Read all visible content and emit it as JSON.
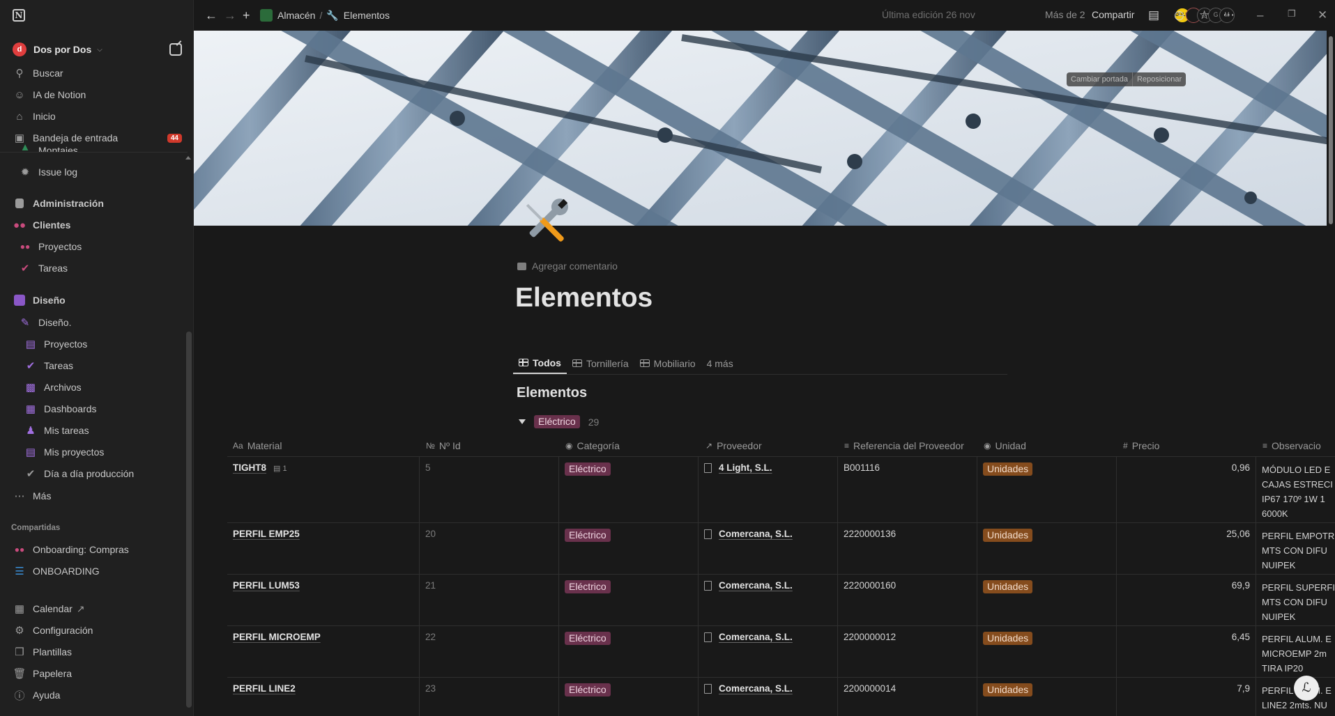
{
  "sidebar": {
    "workspace": "Dos por Dos",
    "workspace_initial": "d",
    "top": [
      {
        "label": "Buscar",
        "icon": "search-icon"
      },
      {
        "label": "IA de Notion",
        "icon": "ai-face-icon"
      },
      {
        "label": "Inicio",
        "icon": "home-icon"
      },
      {
        "label": "Bandeja de entrada",
        "icon": "inbox-icon",
        "badge": "44"
      }
    ],
    "cut_item": "Montajes",
    "pages": [
      {
        "label": "Issue log",
        "icon": "bug-icon"
      },
      {
        "label": "Administración",
        "icon": "document-icon"
      },
      {
        "label": "Clientes",
        "icon": "people-icon"
      },
      {
        "label": "Proyectos",
        "icon": "people-icon"
      },
      {
        "label": "Tareas",
        "icon": "check-circle-icon"
      },
      {
        "label": "Diseño",
        "icon": "pencil-icon"
      },
      {
        "label": "Diseño.",
        "icon": "pencil-icon"
      },
      {
        "label": "Proyectos",
        "icon": "stack-icon"
      },
      {
        "label": "Tareas",
        "icon": "check-circle-icon"
      },
      {
        "label": "Archivos",
        "icon": "archive-icon"
      },
      {
        "label": "Dashboards",
        "icon": "dashboard-icon"
      },
      {
        "label": "Mis tareas",
        "icon": "person-icon"
      },
      {
        "label": "Mis proyectos",
        "icon": "stack-icon"
      },
      {
        "label": "Día a día producción",
        "icon": "check-circle-icon"
      },
      {
        "label": "Más",
        "icon": "more-icon"
      }
    ],
    "shared_section": "Compartidas",
    "shared": [
      {
        "label": "Onboarding: Compras",
        "icon": "people-icon"
      },
      {
        "label": "ONBOARDING",
        "icon": "list-icon"
      }
    ],
    "bottom": [
      {
        "label": "Calendar",
        "icon": "calendar-icon",
        "suffix": "↗"
      },
      {
        "label": "Configuración",
        "icon": "gear-icon"
      },
      {
        "label": "Plantillas",
        "icon": "templates-icon"
      },
      {
        "label": "Papelera",
        "icon": "trash-icon"
      },
      {
        "label": "Ayuda",
        "icon": "help-icon"
      }
    ]
  },
  "topbar": {
    "breadcrumb": [
      "Almacén",
      "Elementos"
    ],
    "last_edit": "Última edición 26 nov",
    "more_people": "Más de 2",
    "share": "Compartir",
    "avatars": [
      "DULUX",
      "",
      "A",
      "G",
      "M"
    ]
  },
  "cover": {
    "change": "Cambiar portada",
    "reposition": "Reposicionar"
  },
  "page": {
    "add_comment": "Agregar comentario",
    "title": "Elementos",
    "tabs": [
      "Todos",
      "Tornillería",
      "Mobiliario",
      "4 más"
    ],
    "db_title": "Elementos",
    "group": {
      "label": "Eléctrico",
      "count": "29"
    }
  },
  "table": {
    "columns": [
      {
        "label": "Material",
        "icon": "Aa"
      },
      {
        "label": "Nº Id",
        "icon": "№"
      },
      {
        "label": "Categoría",
        "icon": "◉"
      },
      {
        "label": "Proveedor",
        "icon": "↗"
      },
      {
        "label": "Referencia del Proveedor",
        "icon": "≡"
      },
      {
        "label": "Unidad",
        "icon": "◉"
      },
      {
        "label": "Precio",
        "icon": "#"
      },
      {
        "label": "Observacio",
        "icon": "≡"
      }
    ],
    "rows": [
      {
        "material": "TIGHT8",
        "comments": "1",
        "id": "5",
        "categoria": "Eléctrico",
        "proveedor": "4 Light, S.L.",
        "ref": "B001116",
        "unidad": "Unidades",
        "precio": "0,96",
        "obs": [
          "MÓDULO LED E",
          "CAJAS ESTRECI",
          "IP67 170º 1W 1",
          "6000K"
        ]
      },
      {
        "material": "PERFIL EMP25",
        "comments": "",
        "id": "20",
        "categoria": "Eléctrico",
        "proveedor": "Comercana, S.L.",
        "ref": "2220000136",
        "unidad": "Unidades",
        "precio": "25,06",
        "obs": [
          "PERFIL EMPOTR",
          "MTS CON DIFU",
          "NUIPEK"
        ]
      },
      {
        "material": "PERFIL LUM53",
        "comments": "",
        "id": "21",
        "categoria": "Eléctrico",
        "proveedor": "Comercana, S.L.",
        "ref": "2220000160",
        "unidad": "Unidades",
        "precio": "69,9",
        "obs": [
          "PERFIL SUPERFI",
          "MTS CON DIFU",
          "NUIPEK"
        ]
      },
      {
        "material": "PERFIL MICROEMP",
        "comments": "",
        "id": "22",
        "categoria": "Eléctrico",
        "proveedor": "Comercana, S.L.",
        "ref": "2200000012",
        "unidad": "Unidades",
        "precio": "6,45",
        "obs": [
          "PERFIL ALUM. E",
          "MICROEMP 2m",
          "TIRA IP20"
        ]
      },
      {
        "material": "PERFIL LINE2",
        "comments": "",
        "id": "23",
        "categoria": "Eléctrico",
        "proveedor": "Comercana, S.L.",
        "ref": "2200000014",
        "unidad": "Unidades",
        "precio": "7,9",
        "obs": [
          "PERFIL ALUM. E",
          "LINE2 2mts. NU"
        ]
      }
    ]
  },
  "colors": {
    "accent_tag": "#69314c",
    "unit_tag": "#854c1d",
    "badge": "#d0392b"
  }
}
